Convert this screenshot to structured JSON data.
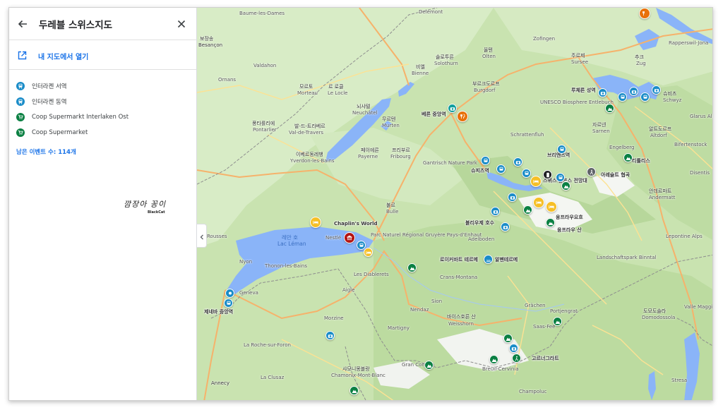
{
  "panel": {
    "title": "두레블 스위스지도",
    "open_label": "내 지도에서 열기",
    "items": [
      {
        "label": "인터라켄 서역",
        "icon": "train-icon",
        "color": "#1a8cc8"
      },
      {
        "label": "인터라켄 동역",
        "icon": "train-icon",
        "color": "#1a8cc8"
      },
      {
        "label": "Coop Supermarkt Interlaken Ost",
        "icon": "cart-icon",
        "color": "#0b8043"
      },
      {
        "label": "Coop Supermarket",
        "icon": "cart-icon",
        "color": "#0b8043"
      }
    ],
    "remaining": "남은 이벤트 수: 114개",
    "signature": {
      "script": "깜장아 꽁이",
      "sub": "BlackCat"
    }
  },
  "map": {
    "places": [
      {
        "t": "Baume-les-Dames"
      },
      {
        "t": "보장송"
      },
      {
        "t": "Besançon"
      },
      {
        "t": "Ornans"
      },
      {
        "t": "Valdahon"
      },
      {
        "t": "모르토"
      },
      {
        "t": "Morteau"
      },
      {
        "t": "르 로클"
      },
      {
        "t": "Le Locle"
      },
      {
        "t": "퐁타를리에"
      },
      {
        "t": "Pontarlier"
      },
      {
        "t": "발-드-트라베르"
      },
      {
        "t": "Val-de-Travers"
      },
      {
        "t": "이베르동레뱅"
      },
      {
        "t": "Yverdon-les-Bains"
      },
      {
        "t": "뇌샤텔"
      },
      {
        "t": "Neuchâtel"
      },
      {
        "t": "페이에른"
      },
      {
        "t": "Payerne"
      },
      {
        "t": "무르텐"
      },
      {
        "t": "Murten"
      },
      {
        "t": "프리부르"
      },
      {
        "t": "Fribourg"
      },
      {
        "t": "불르"
      },
      {
        "t": "Bulle"
      },
      {
        "t": "솔로투른"
      },
      {
        "t": "Solothurn"
      },
      {
        "t": "비엘"
      },
      {
        "t": "Bienne"
      },
      {
        "t": "부르크도르프"
      },
      {
        "t": "Burgdorf"
      },
      {
        "t": "Delémont"
      },
      {
        "t": "Gantrisch Nature Park"
      },
      {
        "t": "올텐"
      },
      {
        "t": "Olten"
      },
      {
        "t": "Zofingen"
      },
      {
        "t": "주르제"
      },
      {
        "t": "Sursee"
      },
      {
        "t": "추크"
      },
      {
        "t": "Zug"
      },
      {
        "t": "슈비츠"
      },
      {
        "t": "Schwyz"
      },
      {
        "t": "자르넨"
      },
      {
        "t": "Sarnen"
      },
      {
        "t": "알트도르프"
      },
      {
        "t": "Altdorf"
      },
      {
        "t": "Engelberg"
      },
      {
        "t": "Schrattenfluh"
      },
      {
        "t": "UNESCO Biosphere Entlebuch"
      },
      {
        "t": "안데르마트"
      },
      {
        "t": "Andermatt"
      },
      {
        "t": "Disentis"
      },
      {
        "t": "Glarus Alps"
      },
      {
        "t": "Bifertenstock"
      },
      {
        "t": "Lepontine Alps"
      },
      {
        "t": "Landschaftspark Binntal"
      },
      {
        "t": "도모도솔라"
      },
      {
        "t": "Domodossola"
      },
      {
        "t": "Saas-Fee"
      },
      {
        "t": "Portjengrat"
      },
      {
        "t": "Grächen"
      },
      {
        "t": "바이스호른 산"
      },
      {
        "t": "Weisshorn"
      },
      {
        "t": "Breuil-Cervinia"
      },
      {
        "t": "Champoluc"
      },
      {
        "t": "Gran Combin"
      },
      {
        "t": "샤모니몽블랑"
      },
      {
        "t": "Chamonix-Mont-Blanc"
      },
      {
        "t": "Martigny"
      },
      {
        "t": "Sion"
      },
      {
        "t": "Crans-Montana"
      },
      {
        "t": "Nendaz"
      },
      {
        "t": "Morzine"
      },
      {
        "t": "Thonon-les-Bains"
      },
      {
        "t": "Geneva"
      },
      {
        "t": "Nyon"
      },
      {
        "t": "Annecy"
      },
      {
        "t": "La Clusaz"
      },
      {
        "t": "La Roche-sur-Foron"
      },
      {
        "t": "Rousses"
      },
      {
        "t": "Nestlé"
      },
      {
        "t": "Les Diablerets"
      },
      {
        "t": "Aigle"
      },
      {
        "t": "Rapperswil-Jona"
      },
      {
        "t": "Stresa"
      },
      {
        "t": "Adelboden"
      },
      {
        "t": "Parc Naturel Régional Gruyère Pays-d'Enhaut"
      },
      {
        "t": "Valle Maggia"
      }
    ],
    "lakes": [
      {
        "t": "레만 호"
      },
      {
        "t": "Lac Léman"
      }
    ],
    "poi_labels": [
      {
        "t": "베른 중앙역"
      },
      {
        "t": "Chaplin's World"
      },
      {
        "t": "제네바 중앙역"
      },
      {
        "t": "루체른 성역"
      },
      {
        "t": "티틀리스"
      },
      {
        "t": "아레슐트 협곡"
      },
      {
        "t": "브리엔츠역"
      },
      {
        "t": "슈피츠역"
      },
      {
        "t": "융프라우요흐"
      },
      {
        "t": "융프라우 산"
      },
      {
        "t": "블리우제 호수"
      },
      {
        "t": "로이커바트 테르메"
      },
      {
        "t": "알펜테르메"
      },
      {
        "t": "고르너그라트"
      },
      {
        "t": "스위스 알프스 전망대"
      }
    ]
  }
}
